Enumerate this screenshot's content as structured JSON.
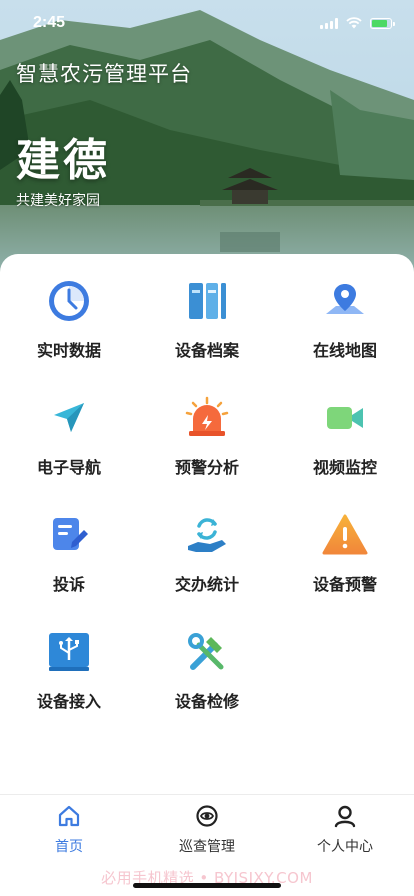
{
  "status_bar": {
    "time": "2:45"
  },
  "header": {
    "app_title": "智慧农污管理平台"
  },
  "hero": {
    "city": "建德",
    "slogan": "共建美好家园"
  },
  "menu": {
    "items": [
      {
        "label": "实时数据",
        "icon": "clock-icon"
      },
      {
        "label": "设备档案",
        "icon": "archive-icon"
      },
      {
        "label": "在线地图",
        "icon": "map-pin-icon"
      },
      {
        "label": "电子导航",
        "icon": "navigation-arrow-icon"
      },
      {
        "label": "预警分析",
        "icon": "alarm-siren-icon"
      },
      {
        "label": "视频监控",
        "icon": "video-camera-icon"
      },
      {
        "label": "投诉",
        "icon": "edit-document-icon"
      },
      {
        "label": "交办统计",
        "icon": "handover-refresh-icon"
      },
      {
        "label": "设备预警",
        "icon": "warning-triangle-icon"
      },
      {
        "label": "设备接入",
        "icon": "usb-device-icon"
      },
      {
        "label": "设备检修",
        "icon": "repair-tools-icon"
      }
    ]
  },
  "bottom_nav": {
    "items": [
      {
        "label": "首页",
        "icon": "home-icon"
      },
      {
        "label": "巡查管理",
        "icon": "eye-icon"
      },
      {
        "label": "个人中心",
        "icon": "user-icon"
      }
    ]
  },
  "footer": {
    "watermark": "必用手机精选 • BYJSJXY.COM"
  },
  "colors": {
    "accent": "#3d7be0",
    "watermark": "#f6c6cf"
  }
}
